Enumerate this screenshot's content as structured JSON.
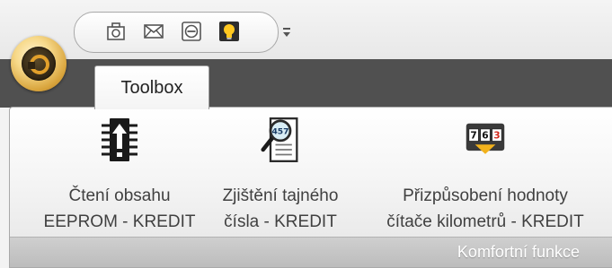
{
  "quick_access": {
    "icons": [
      "camera-icon",
      "mail-icon",
      "minus-icon",
      "bulb-icon"
    ]
  },
  "tabs": [
    {
      "label": "Toolbox",
      "active": true
    }
  ],
  "ribbon": {
    "commands": [
      {
        "line1": "Čtení obsahu",
        "line2": "EEPROM  - KREDIT",
        "icon": "chip-upload-icon"
      },
      {
        "line1": "Zjištění tajného",
        "line2": "čísla  - KREDIT",
        "icon": "magnifier-document-icon"
      },
      {
        "line1": "Přizpůsobení hodnoty",
        "line2": "čítače kilometrů  - KREDIT",
        "icon": "odometer-icon"
      }
    ],
    "group_label": "Komfortní funkce",
    "odometer_digits": [
      "7",
      "6",
      "3"
    ]
  },
  "colors": {
    "band": "#505050",
    "accent": "#e2a02b",
    "odometer_red": "#d22a1e"
  }
}
